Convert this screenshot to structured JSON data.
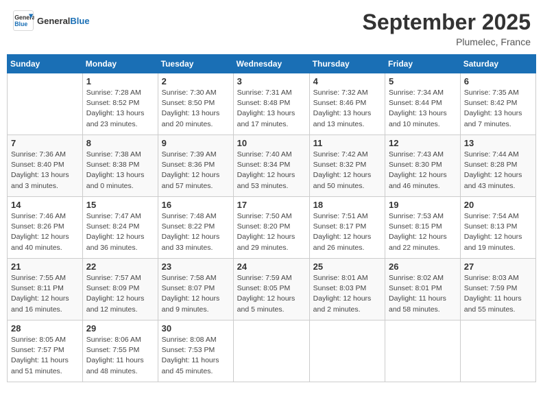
{
  "header": {
    "logo_line1": "General",
    "logo_line2": "Blue",
    "main_title": "September 2025",
    "subtitle": "Plumelec, France"
  },
  "days_of_week": [
    "Sunday",
    "Monday",
    "Tuesday",
    "Wednesday",
    "Thursday",
    "Friday",
    "Saturday"
  ],
  "weeks": [
    [
      {
        "day": "",
        "info": ""
      },
      {
        "day": "1",
        "info": "Sunrise: 7:28 AM\nSunset: 8:52 PM\nDaylight: 13 hours\nand 23 minutes."
      },
      {
        "day": "2",
        "info": "Sunrise: 7:30 AM\nSunset: 8:50 PM\nDaylight: 13 hours\nand 20 minutes."
      },
      {
        "day": "3",
        "info": "Sunrise: 7:31 AM\nSunset: 8:48 PM\nDaylight: 13 hours\nand 17 minutes."
      },
      {
        "day": "4",
        "info": "Sunrise: 7:32 AM\nSunset: 8:46 PM\nDaylight: 13 hours\nand 13 minutes."
      },
      {
        "day": "5",
        "info": "Sunrise: 7:34 AM\nSunset: 8:44 PM\nDaylight: 13 hours\nand 10 minutes."
      },
      {
        "day": "6",
        "info": "Sunrise: 7:35 AM\nSunset: 8:42 PM\nDaylight: 13 hours\nand 7 minutes."
      }
    ],
    [
      {
        "day": "7",
        "info": "Sunrise: 7:36 AM\nSunset: 8:40 PM\nDaylight: 13 hours\nand 3 minutes."
      },
      {
        "day": "8",
        "info": "Sunrise: 7:38 AM\nSunset: 8:38 PM\nDaylight: 13 hours\nand 0 minutes."
      },
      {
        "day": "9",
        "info": "Sunrise: 7:39 AM\nSunset: 8:36 PM\nDaylight: 12 hours\nand 57 minutes."
      },
      {
        "day": "10",
        "info": "Sunrise: 7:40 AM\nSunset: 8:34 PM\nDaylight: 12 hours\nand 53 minutes."
      },
      {
        "day": "11",
        "info": "Sunrise: 7:42 AM\nSunset: 8:32 PM\nDaylight: 12 hours\nand 50 minutes."
      },
      {
        "day": "12",
        "info": "Sunrise: 7:43 AM\nSunset: 8:30 PM\nDaylight: 12 hours\nand 46 minutes."
      },
      {
        "day": "13",
        "info": "Sunrise: 7:44 AM\nSunset: 8:28 PM\nDaylight: 12 hours\nand 43 minutes."
      }
    ],
    [
      {
        "day": "14",
        "info": "Sunrise: 7:46 AM\nSunset: 8:26 PM\nDaylight: 12 hours\nand 40 minutes."
      },
      {
        "day": "15",
        "info": "Sunrise: 7:47 AM\nSunset: 8:24 PM\nDaylight: 12 hours\nand 36 minutes."
      },
      {
        "day": "16",
        "info": "Sunrise: 7:48 AM\nSunset: 8:22 PM\nDaylight: 12 hours\nand 33 minutes."
      },
      {
        "day": "17",
        "info": "Sunrise: 7:50 AM\nSunset: 8:20 PM\nDaylight: 12 hours\nand 29 minutes."
      },
      {
        "day": "18",
        "info": "Sunrise: 7:51 AM\nSunset: 8:17 PM\nDaylight: 12 hours\nand 26 minutes."
      },
      {
        "day": "19",
        "info": "Sunrise: 7:53 AM\nSunset: 8:15 PM\nDaylight: 12 hours\nand 22 minutes."
      },
      {
        "day": "20",
        "info": "Sunrise: 7:54 AM\nSunset: 8:13 PM\nDaylight: 12 hours\nand 19 minutes."
      }
    ],
    [
      {
        "day": "21",
        "info": "Sunrise: 7:55 AM\nSunset: 8:11 PM\nDaylight: 12 hours\nand 16 minutes."
      },
      {
        "day": "22",
        "info": "Sunrise: 7:57 AM\nSunset: 8:09 PM\nDaylight: 12 hours\nand 12 minutes."
      },
      {
        "day": "23",
        "info": "Sunrise: 7:58 AM\nSunset: 8:07 PM\nDaylight: 12 hours\nand 9 minutes."
      },
      {
        "day": "24",
        "info": "Sunrise: 7:59 AM\nSunset: 8:05 PM\nDaylight: 12 hours\nand 5 minutes."
      },
      {
        "day": "25",
        "info": "Sunrise: 8:01 AM\nSunset: 8:03 PM\nDaylight: 12 hours\nand 2 minutes."
      },
      {
        "day": "26",
        "info": "Sunrise: 8:02 AM\nSunset: 8:01 PM\nDaylight: 11 hours\nand 58 minutes."
      },
      {
        "day": "27",
        "info": "Sunrise: 8:03 AM\nSunset: 7:59 PM\nDaylight: 11 hours\nand 55 minutes."
      }
    ],
    [
      {
        "day": "28",
        "info": "Sunrise: 8:05 AM\nSunset: 7:57 PM\nDaylight: 11 hours\nand 51 minutes."
      },
      {
        "day": "29",
        "info": "Sunrise: 8:06 AM\nSunset: 7:55 PM\nDaylight: 11 hours\nand 48 minutes."
      },
      {
        "day": "30",
        "info": "Sunrise: 8:08 AM\nSunset: 7:53 PM\nDaylight: 11 hours\nand 45 minutes."
      },
      {
        "day": "",
        "info": ""
      },
      {
        "day": "",
        "info": ""
      },
      {
        "day": "",
        "info": ""
      },
      {
        "day": "",
        "info": ""
      }
    ]
  ]
}
